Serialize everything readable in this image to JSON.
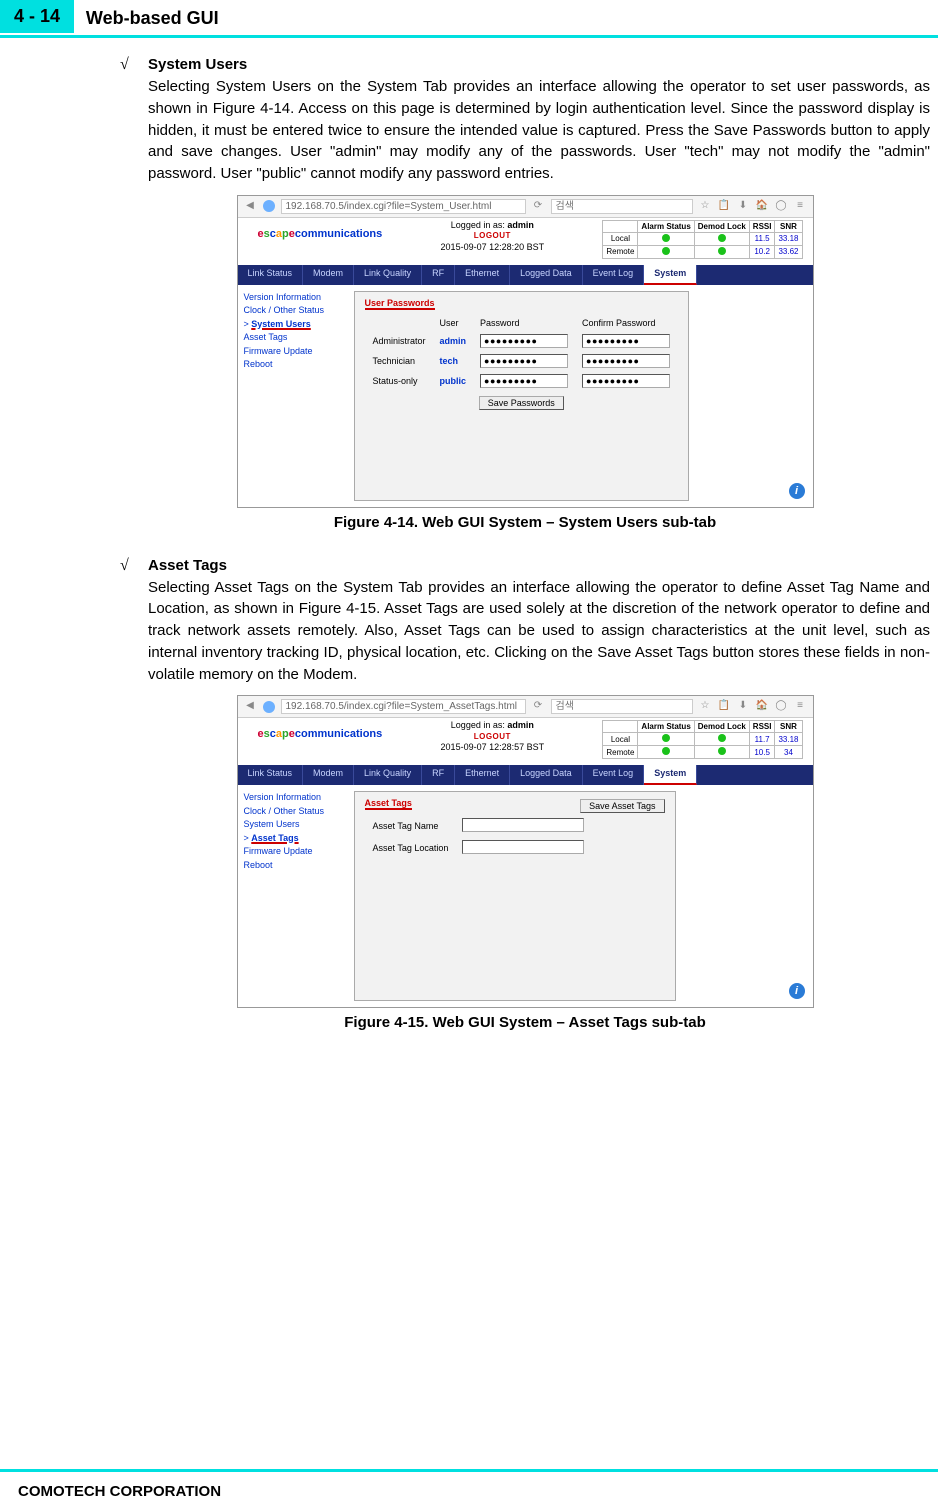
{
  "header": {
    "page_number": "4 - 14",
    "title": "Web-based GUI"
  },
  "section1": {
    "bullet": "√",
    "heading": "System Users",
    "paragraph": "Selecting System Users on the System Tab provides an interface allowing the operator to set user passwords, as shown in Figure 4-14. Access on this page is determined by login authentication level. Since the password display is hidden, it must be entered twice to ensure the intended value is captured. Press the Save Passwords button to apply and save changes. User \"admin\" may modify any of the passwords. User \"tech\" may not modify the \"admin\" password. User \"public\" cannot modify any password entries.",
    "caption": "Figure 4-14. Web GUI System – System Users sub-tab"
  },
  "section2": {
    "bullet": "√",
    "heading": "Asset Tags",
    "paragraph": "Selecting Asset Tags on the System Tab provides an interface allowing the operator to define Asset Tag Name and Location, as shown in Figure 4-15. Asset Tags are used solely at the discretion of the network operator to define and track network assets remotely. Also, Asset Tags can be used to assign characteristics at the unit level, such as internal inventory tracking ID, physical location, etc. Clicking on the Save Asset Tags button stores these fields in non-volatile memory on the Modem.",
    "caption": "Figure 4-15. Web GUI System – Asset Tags sub-tab"
  },
  "shot_common": {
    "logged_in_prefix": "Logged in as: ",
    "logged_in_user": "admin",
    "logout": "LOGOUT",
    "status_headers": [
      "Alarm Status",
      "Demod Lock",
      "RSSI",
      "SNR"
    ],
    "status_rows_label_local": "Local",
    "status_rows_label_remote": "Remote",
    "nav": [
      "Link\nStatus",
      "Modem",
      "Link\nQuality",
      "RF",
      "Ethernet",
      "Logged\nData",
      "Event\nLog",
      "System"
    ],
    "sidemenu": [
      "Version Information",
      "Clock / Other Status",
      "System Users",
      "Asset Tags",
      "Firmware Update",
      "Reboot"
    ]
  },
  "shot1": {
    "url": "192.168.70.5/index.cgi?file=System_User.html",
    "search_ph": "검색",
    "timestamp": "2015-09-07 12:28:20 BST",
    "local": {
      "rssi": "11.5",
      "snr": "33.18"
    },
    "remote": {
      "rssi": "10.2",
      "snr": "33.62"
    },
    "form_title": "User Passwords",
    "cols": [
      "User",
      "Password",
      "Confirm Password"
    ],
    "rows": [
      {
        "role": "Administrator",
        "user": "admin"
      },
      {
        "role": "Technician",
        "user": "tech"
      },
      {
        "role": "Status-only",
        "user": "public"
      }
    ],
    "pw_mask": "●●●●●●●●●",
    "save_btn": "Save Passwords",
    "selected_menu_index": 2
  },
  "shot2": {
    "url": "192.168.70.5/index.cgi?file=System_AssetTags.html",
    "search_ph": "검색",
    "timestamp": "2015-09-07 12:28:57 BST",
    "local": {
      "rssi": "11.7",
      "snr": "33.18"
    },
    "remote": {
      "rssi": "10.5",
      "snr": "34"
    },
    "form_title": "Asset Tags",
    "save_btn": "Save Asset Tags",
    "field1": "Asset Tag Name",
    "field2": "Asset Tag Location",
    "selected_menu_index": 3
  },
  "footer": "COMOTECH CORPORATION",
  "chart_data": {
    "type": "table",
    "title": "Status readings embedded in screenshots",
    "series": [
      {
        "name": "Figure 4-14 Local",
        "values": {
          "RSSI": 11.5,
          "SNR": 33.18
        }
      },
      {
        "name": "Figure 4-14 Remote",
        "values": {
          "RSSI": 10.2,
          "SNR": 33.62
        }
      },
      {
        "name": "Figure 4-15 Local",
        "values": {
          "RSSI": 11.7,
          "SNR": 33.18
        }
      },
      {
        "name": "Figure 4-15 Remote",
        "values": {
          "RSSI": 10.5,
          "SNR": 34
        }
      }
    ]
  }
}
